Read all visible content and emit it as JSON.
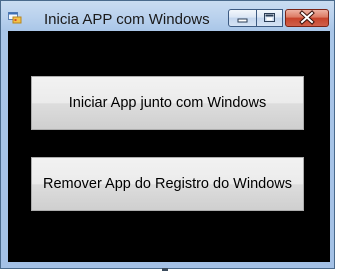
{
  "window": {
    "title": "Inicia APP com Windows",
    "icon": "app-form-icon",
    "controls": {
      "minimize_icon": "minimize-icon",
      "maximize_icon": "maximize-icon",
      "close_icon": "close-icon"
    }
  },
  "buttons": {
    "start_label": "Iniciar App junto com Windows",
    "remove_label": "Remover App do Registro do Windows"
  },
  "colors": {
    "client_background": "#000000",
    "titlebar": "#bcd3ee",
    "close_button": "#c7432a"
  }
}
